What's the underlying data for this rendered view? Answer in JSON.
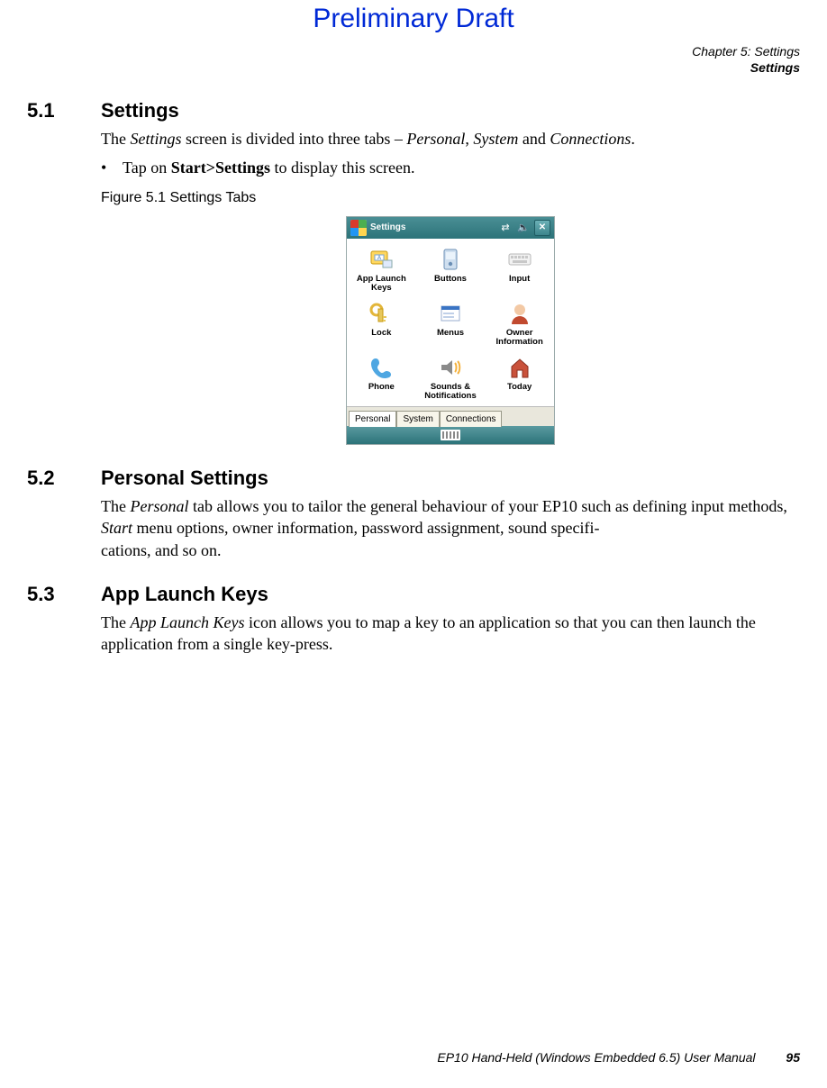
{
  "draft_banner": "Preliminary Draft",
  "chapter_header": {
    "line1": "Chapter 5: Settings",
    "line2": "Settings"
  },
  "sections": {
    "s1": {
      "num": "5.1",
      "title": "Settings",
      "para_pre": "The ",
      "para_em1": "Settings",
      "para_mid1": " screen is divided into three tabs – ",
      "para_em2": "Personal",
      "para_sep1": ", ",
      "para_em3": "System",
      "para_sep2": " and ",
      "para_em4": "Connections",
      "para_end": ".",
      "bullet_pre": "Tap on ",
      "bullet_strong": "Start>Settings",
      "bullet_post": " to display this screen.",
      "fig_caption": "Figure 5.1  Settings Tabs"
    },
    "s2": {
      "num": "5.2",
      "title": "Personal Settings",
      "para_pre": "The ",
      "para_em1": "Personal",
      "para_mid1": " tab allows you to tailor the general behaviour of your EP10 such as defining input methods, ",
      "para_em2": "Start",
      "para_mid2": " menu options, owner information, password assignment, sound specifi-",
      "para_line2": "cations, and so on."
    },
    "s3": {
      "num": "5.3",
      "title": "App Launch Keys",
      "para_pre": "The ",
      "para_em1": "App Launch Keys",
      "para_post": " icon allows you to map a key to an application so that you can then launch the application from a single key-press."
    }
  },
  "device": {
    "title": "Settings",
    "items": [
      {
        "label": "App Launch Keys"
      },
      {
        "label": "Buttons"
      },
      {
        "label": "Input"
      },
      {
        "label": "Lock"
      },
      {
        "label": "Menus"
      },
      {
        "label": "Owner Information"
      },
      {
        "label": "Phone"
      },
      {
        "label": "Sounds & Notifications"
      },
      {
        "label": "Today"
      }
    ],
    "tabs": {
      "t1": "Personal",
      "t2": "System",
      "t3": "Connections"
    }
  },
  "footer": {
    "manual": "EP10 Hand-Held (Windows Embedded 6.5) User Manual",
    "page": "95"
  }
}
